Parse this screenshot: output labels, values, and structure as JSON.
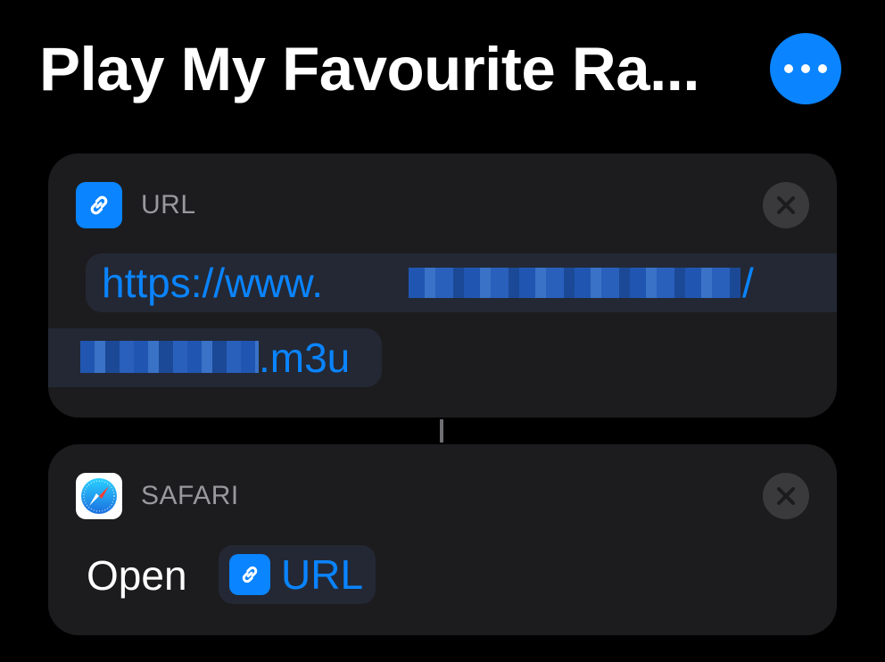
{
  "header": {
    "title": "Play My Favourite Ra...",
    "more_icon": "ellipsis-icon"
  },
  "colors": {
    "accent": "#0a84ff",
    "background": "#000000",
    "card": "#1c1c1e",
    "secondary_text": "#98989d"
  },
  "actions": [
    {
      "label": "URL",
      "icon": "link-icon",
      "remove_icon": "close-icon",
      "url_line1_prefix": "https://www.",
      "url_line1_suffix": "/",
      "url_line2_suffix": ".m3u"
    },
    {
      "label": "SAFARI",
      "icon": "safari-compass-icon",
      "remove_icon": "close-icon",
      "verb": "Open",
      "variable": {
        "label": "URL",
        "icon": "link-icon"
      }
    }
  ]
}
